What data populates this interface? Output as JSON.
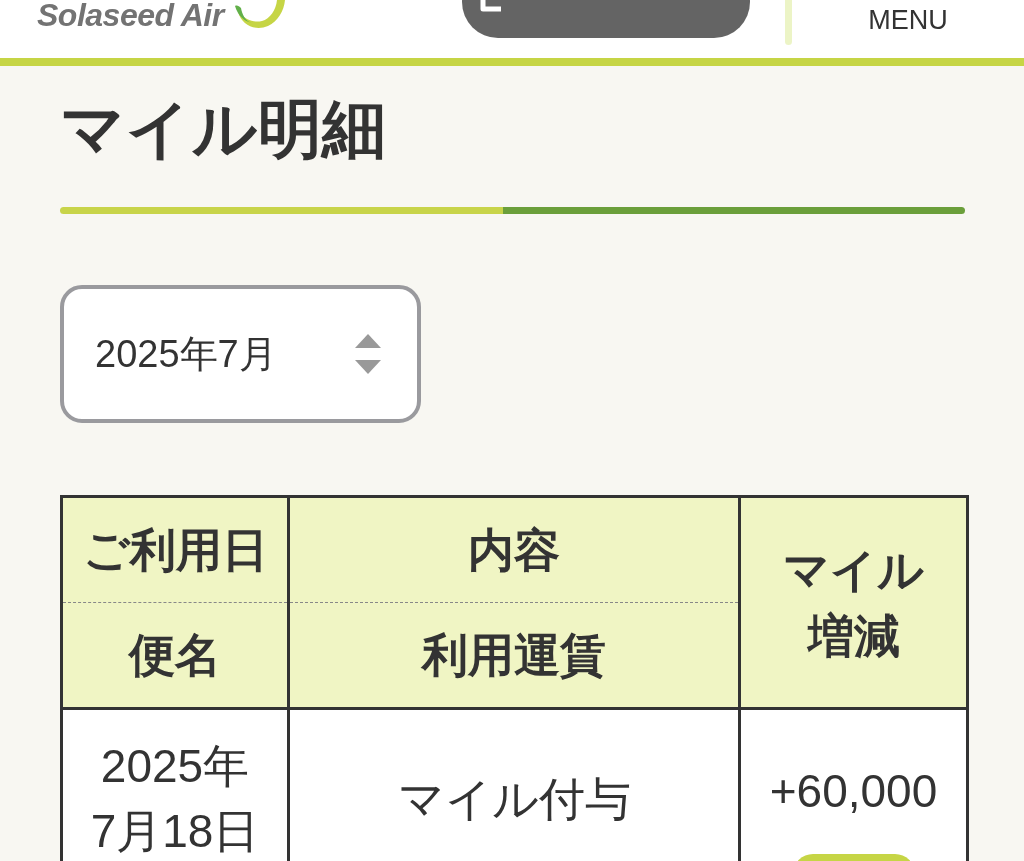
{
  "header": {
    "logo_text": "Solaseed Air",
    "menu_label": "MENU"
  },
  "page_title": "マイル明細",
  "month_select": {
    "value": "2025年7月"
  },
  "table": {
    "columns": [
      {
        "kind": "split",
        "top": "ご利用日",
        "bottom": "便名"
      },
      {
        "kind": "split",
        "top": "内容",
        "bottom": "利用運賃"
      },
      {
        "kind": "single",
        "lines": [
          "マイル",
          "増減"
        ]
      }
    ],
    "rows": [
      {
        "date_lines": [
          "2025年",
          "7月18日"
        ],
        "content": "マイル付与",
        "miles": "+60,000"
      }
    ]
  }
}
